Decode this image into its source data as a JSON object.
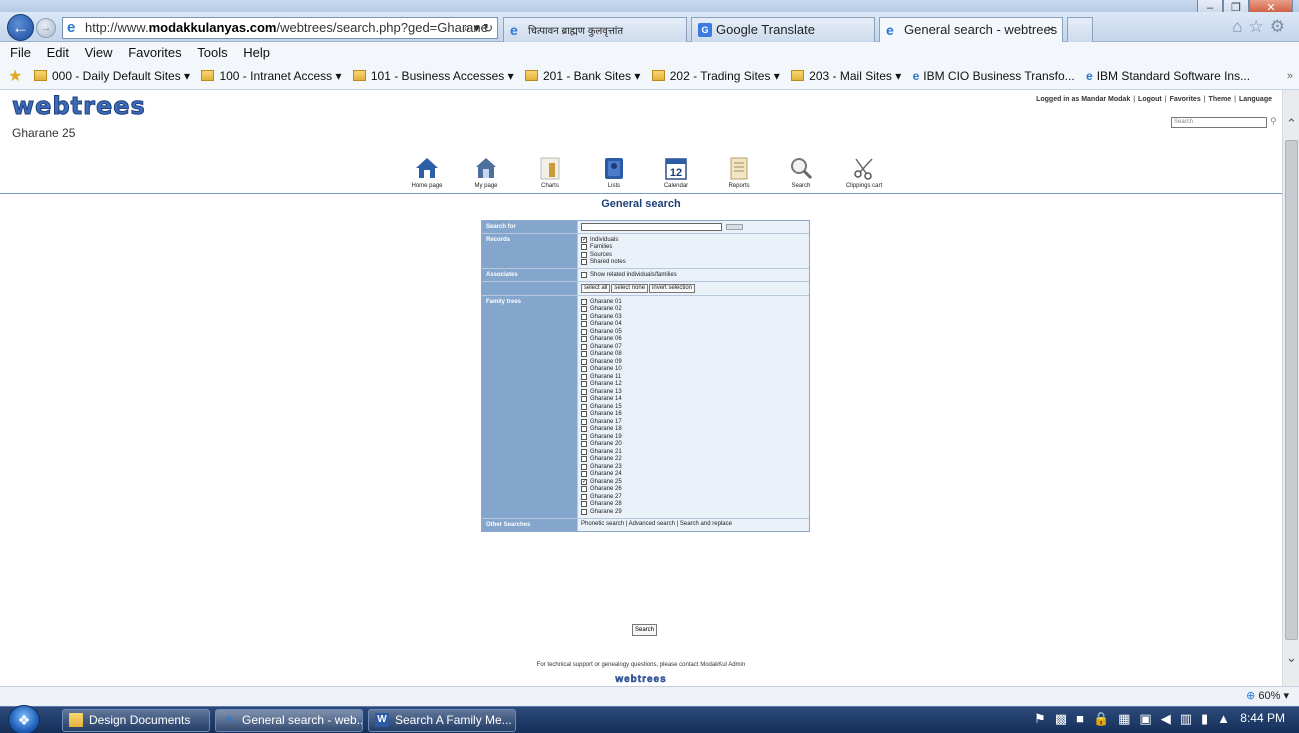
{
  "browser": {
    "address_url_prefix": "http://www.",
    "address_url_domain": "modakkulanyas.com",
    "address_url_path": "/webtrees/search.php?ged=Gharane",
    "address_tools": "⌕ ▾ ↻",
    "tabs": [
      {
        "label": "चित्पावन ब्राह्मण कुलवृत्तांत"
      },
      {
        "label": "Google Translate"
      },
      {
        "label": "General search - webtrees",
        "close": "×"
      }
    ],
    "nav_icons": "⌂☆⚙"
  },
  "menubar": [
    "File",
    "Edit",
    "View",
    "Favorites",
    "Tools",
    "Help"
  ],
  "favorites": [
    {
      "label": "000 - Daily Default Sites ▾",
      "type": "folder"
    },
    {
      "label": "100 - Intranet Access ▾",
      "type": "folder"
    },
    {
      "label": "101 - Business Accesses ▾",
      "type": "folder"
    },
    {
      "label": "201 - Bank Sites ▾",
      "type": "folder"
    },
    {
      "label": "202 - Trading Sites ▾",
      "type": "folder"
    },
    {
      "label": "203 - Mail Sites ▾",
      "type": "folder"
    },
    {
      "label": "IBM CIO Business Transfo...",
      "type": "page"
    },
    {
      "label": "IBM Standard Software Ins...",
      "type": "page"
    }
  ],
  "site": {
    "logo": "webtrees",
    "tree_name": "Gharane 25",
    "user_links": [
      "Logged in as Mandar Modak",
      "Logout",
      "Favorites",
      "Theme",
      "Language"
    ],
    "search_placeholder": "Search",
    "menu": [
      {
        "label": "Home page",
        "icon": "home-icon"
      },
      {
        "label": "My page",
        "icon": "my-page-icon"
      },
      {
        "label": "Charts",
        "icon": "charts-icon"
      },
      {
        "label": "Lists",
        "icon": "lists-icon"
      },
      {
        "label": "Calendar",
        "icon": "calendar-icon",
        "day": "12"
      },
      {
        "label": "Reports",
        "icon": "reports-icon"
      },
      {
        "label": "Search",
        "icon": "search-icon"
      },
      {
        "label": "Clippings cart",
        "icon": "scissors-icon"
      }
    ]
  },
  "search_form": {
    "title": "General search",
    "search_for_label": "Search for",
    "search_for_value": "",
    "records_label": "Records",
    "records": [
      {
        "label": "Individuals",
        "checked": true
      },
      {
        "label": "Families",
        "checked": false
      },
      {
        "label": "Sources",
        "checked": false
      },
      {
        "label": "Shared notes",
        "checked": false
      }
    ],
    "associates_label": "Associates",
    "associates_option": "Show related individuals/families",
    "select_buttons": [
      "select all",
      "select none",
      "invert selection"
    ],
    "family_trees_label": "Family trees",
    "family_trees": [
      {
        "label": "Gharane 01",
        "checked": false
      },
      {
        "label": "Gharane 02",
        "checked": false
      },
      {
        "label": "Gharane 03",
        "checked": false
      },
      {
        "label": "Gharane 04",
        "checked": false
      },
      {
        "label": "Gharane 05",
        "checked": false
      },
      {
        "label": "Gharane 06",
        "checked": false
      },
      {
        "label": "Gharane 07",
        "checked": false
      },
      {
        "label": "Gharane 08",
        "checked": false
      },
      {
        "label": "Gharane 09",
        "checked": false
      },
      {
        "label": "Gharane 10",
        "checked": false
      },
      {
        "label": "Gharane 11",
        "checked": false
      },
      {
        "label": "Gharane 12",
        "checked": false
      },
      {
        "label": "Gharane 13",
        "checked": false
      },
      {
        "label": "Gharane 14",
        "checked": false
      },
      {
        "label": "Gharane 15",
        "checked": false
      },
      {
        "label": "Gharane 16",
        "checked": false
      },
      {
        "label": "Gharane 17",
        "checked": false
      },
      {
        "label": "Gharane 18",
        "checked": false
      },
      {
        "label": "Gharane 19",
        "checked": false
      },
      {
        "label": "Gharane 20",
        "checked": false
      },
      {
        "label": "Gharane 21",
        "checked": false
      },
      {
        "label": "Gharane 22",
        "checked": false
      },
      {
        "label": "Gharane 23",
        "checked": false
      },
      {
        "label": "Gharane 24",
        "checked": false
      },
      {
        "label": "Gharane 25",
        "checked": true
      },
      {
        "label": "Gharane 26",
        "checked": false
      },
      {
        "label": "Gharane 27",
        "checked": false
      },
      {
        "label": "Gharane 28",
        "checked": false
      },
      {
        "label": "Gharane 29",
        "checked": false
      }
    ],
    "other_searches_label": "Other Searches",
    "other_searches": [
      "Phonetic search",
      "Advanced search",
      "Search and replace"
    ],
    "submit_label": "Search"
  },
  "footer": {
    "support_text": "For technical support or genealogy questions, please contact ModakKul Admin",
    "logo": "webtrees"
  },
  "statusbar": {
    "zoom": "60%"
  },
  "taskbar": {
    "items": [
      {
        "label": "Design Documents",
        "icon": "folder-icon"
      },
      {
        "label": "General search - web...",
        "icon": "ie-icon"
      },
      {
        "label": "Search A Family Me...",
        "icon": "word-icon"
      }
    ],
    "clock": "8:44 PM"
  },
  "colors": {
    "accent": "#84a5cc",
    "title_blue": "#1c3e75",
    "logo_blue": "#3e6bb8"
  }
}
